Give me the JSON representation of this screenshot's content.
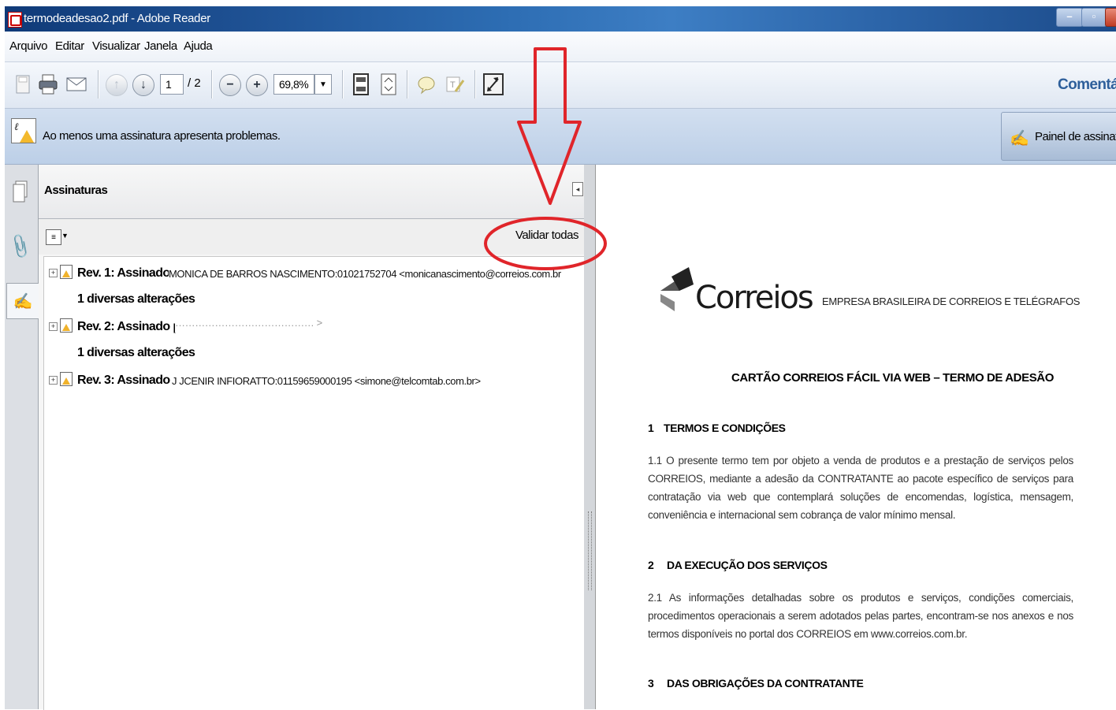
{
  "window": {
    "title": "termodeadesao2.pdf - Adobe Reader"
  },
  "menu": [
    "Arquivo",
    "Editar",
    "Visualizar",
    "Janela",
    "Ajuda"
  ],
  "toolbar": {
    "page_current": "1",
    "page_total": "/ 2",
    "zoom": "69,8%",
    "comment_link": "Comentár"
  },
  "message_bar": {
    "text": "Ao menos uma assinatura apresenta problemas.",
    "button": "Painel de assinatura"
  },
  "panel": {
    "title": "Assinaturas",
    "validate_all": "Validar todas",
    "signatures": [
      {
        "label": "Rev. 1: Assinado por",
        "signer": "MONICA DE BARROS NASCIMENTO:01021752704 <monicanascimento@correios.com.br",
        "details": "1 diversas alterações"
      },
      {
        "label": "Rev. 2: Assinado por",
        "signer": "…………………………………… >",
        "details": "1 diversas alterações"
      },
      {
        "label": "Rev. 3: Assinado por",
        "signer": "J JCENIR INFIORATTO:01159659000195 <simone@telcomtab.com.br>",
        "details": ""
      }
    ]
  },
  "document": {
    "logo_text": "Correios",
    "company": "EMPRESA BRASILEIRA DE CORREIOS E TELÉGRAFOS",
    "title": "CARTÃO CORREIOS FÁCIL VIA WEB – TERMO DE ADESÃO",
    "sections": [
      {
        "num": "1",
        "title": "TERMOS E CONDIÇÕES",
        "text": "1.1 O presente termo tem por objeto a venda de produtos e a prestação de serviços pelos CORREIOS, mediante a adesão da CONTRATANTE ao pacote específico de serviços para contratação via web que contemplará soluções de encomendas, logística, mensagem, conveniência e internacional sem cobrança de valor mínimo mensal."
      },
      {
        "num": "2",
        "title": "DA EXECUÇÃO DOS SERVIÇOS",
        "text": "2.1 As informações detalhadas sobre os produtos e serviços, condições comerciais, procedimentos operacionais a serem adotados pelas partes, encontram-se nos anexos e nos termos disponíveis no portal dos CORREIOS em www.correios.com.br."
      },
      {
        "num": "3",
        "title": "DAS OBRIGAÇÕES DA CONTRATANTE",
        "text": ""
      }
    ]
  },
  "colors": {
    "annotation": "#e0252a",
    "title_bar": "#1d4f91",
    "message_bar": "#c7d7ec"
  }
}
